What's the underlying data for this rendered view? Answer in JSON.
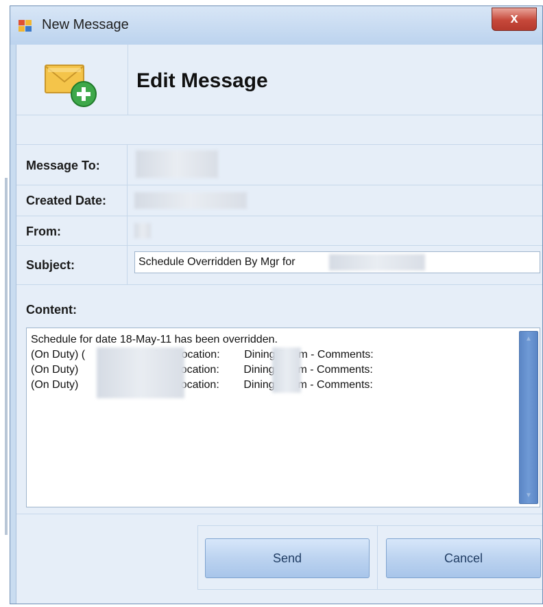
{
  "window": {
    "title": "New Message",
    "close_glyph": "x",
    "icon": "app-message-icon"
  },
  "header": {
    "title": "Edit Message",
    "icon": "envelope-add-icon"
  },
  "fields": {
    "message_to": {
      "label": "Message To:"
    },
    "created_date": {
      "label": "Created Date:"
    },
    "from": {
      "label": "From:"
    },
    "subject": {
      "label": "Subject:",
      "value": "Schedule Overridden By Mgr for"
    }
  },
  "content": {
    "label": "Content:",
    "text": "Schedule for date 18-May-11 has been overridden.\n(On Duty) (                    - Sub Location:        Dining Room - Comments:\n(On Duty)                      - Sub Location:        Dining Room - Comments:\n(On Duty)                      - Sub Location:        Dining Room - Comments:"
  },
  "buttons": {
    "send": "Send",
    "cancel": "Cancel"
  },
  "colors": {
    "scrollbar": "#6f9ad6",
    "close_button": "#c6483a",
    "button_face": "#bcd3f0"
  }
}
